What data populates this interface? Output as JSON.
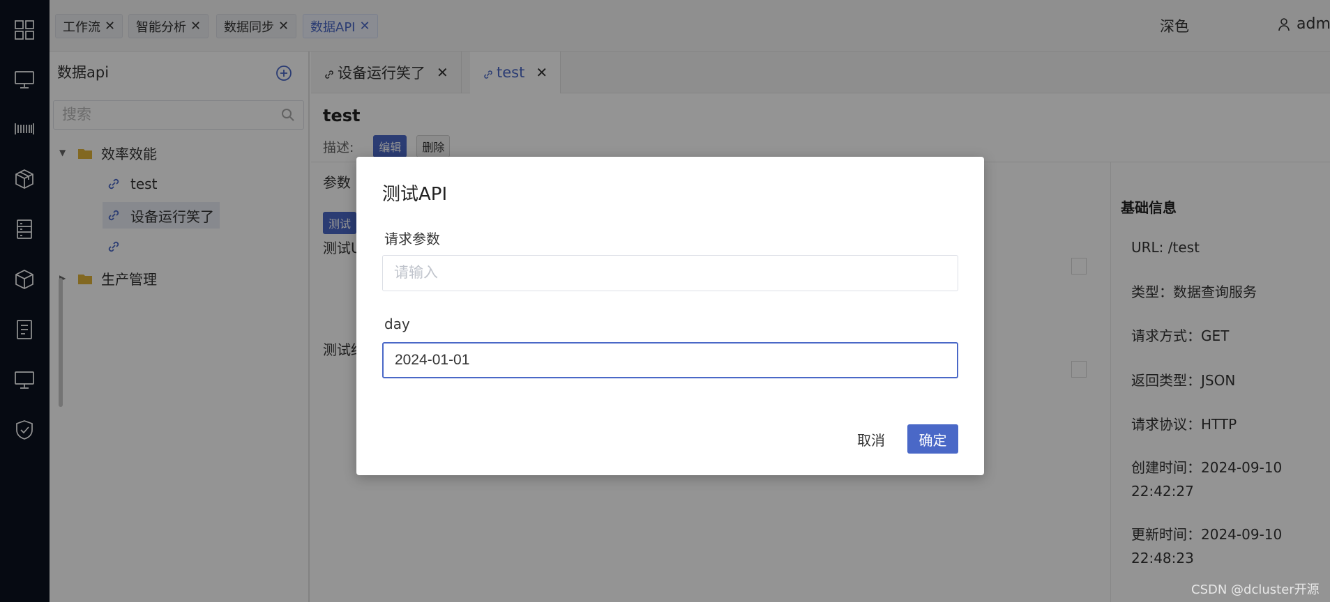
{
  "rail": {
    "icons": [
      "grid-icon",
      "monitor-icon",
      "barcode-icon",
      "cube-icon",
      "server-icon",
      "box-icon",
      "document-icon",
      "desktop-icon",
      "shield-check-icon"
    ]
  },
  "topbar": {
    "tabs": [
      {
        "label": "工作流"
      },
      {
        "label": "智能分析"
      },
      {
        "label": "数据同步"
      },
      {
        "label": "数据API"
      }
    ],
    "theme_label": "深色",
    "username": "admin"
  },
  "sidebar": {
    "title": "数据api",
    "search_placeholder": "搜索",
    "tree": {
      "folder1": "效率效能",
      "item1": "test",
      "item2": "设备运行笑了",
      "item3": "",
      "folder2": "生产管理"
    }
  },
  "main": {
    "tabs": [
      {
        "label": "设备运行笑了"
      },
      {
        "label": "test"
      }
    ],
    "api_title": "test",
    "desc_label": "描述:",
    "edit_label": "编辑",
    "delete_label": "删除",
    "params_label": "参数",
    "test_button": "测试",
    "test_url_label": "测试U",
    "test_result_label": "测试结",
    "info": {
      "title": "基础信息",
      "url": "URL: /test",
      "type": "类型：数据查询服务",
      "method": "请求方式：GET",
      "return_type": "返回类型：JSON",
      "protocol": "请求协议：HTTP",
      "created": "创建时间：2024-09-10 22:42:27",
      "updated": "更新时间：2024-09-10 22:48:23"
    }
  },
  "modal": {
    "title": "测试API",
    "param_label": "请求参数",
    "param_placeholder": "请输入",
    "day_label": "day",
    "day_value": "2024-01-01",
    "cancel_label": "取消",
    "ok_label": "确定"
  },
  "watermark": "CSDN @dcluster开源",
  "colors": {
    "accent": "#4a68c7",
    "rail": "#0b1220"
  }
}
